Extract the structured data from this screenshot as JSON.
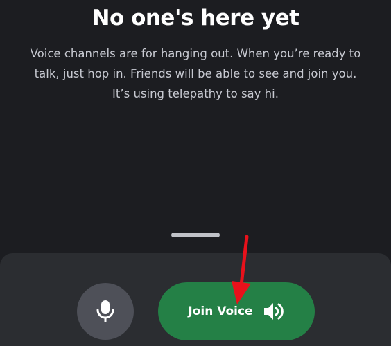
{
  "empty_state": {
    "title": "No one's here yet",
    "description_lines": [
      "Voice channels are for hanging out. When you’re ready to",
      "talk, just hop in. Friends will be able to see and join you.",
      "It’s using telepathy to say hi."
    ]
  },
  "controls": {
    "mic_icon": "microphone-icon",
    "join_label": "Join Voice",
    "join_icon": "speaker-icon"
  },
  "colors": {
    "background": "#1c1d21",
    "sheet": "#2b2d31",
    "join_button": "#248046",
    "mic_button": "#4e5058",
    "annotation_arrow": "#e8111b"
  }
}
